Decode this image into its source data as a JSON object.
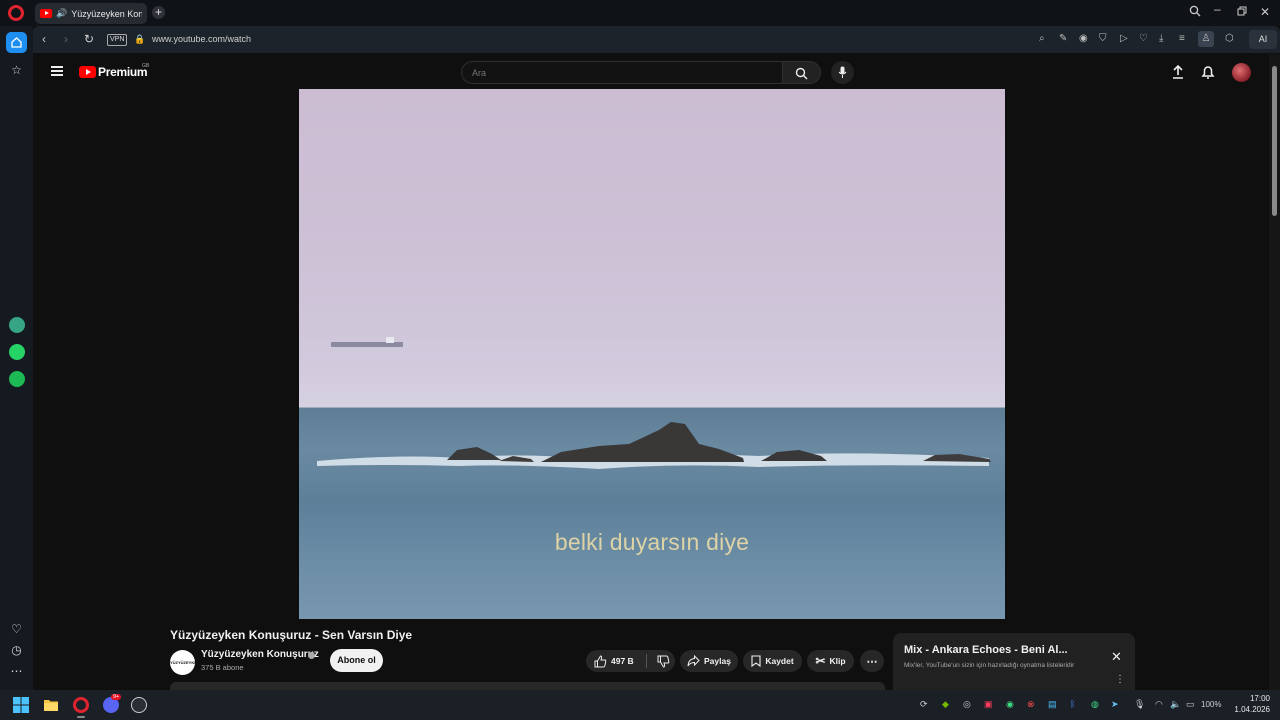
{
  "browser": {
    "tab_title": "Yüzyüzeyken Konuşuruz",
    "new_tab_symbol": "+",
    "vpn_label": "VPN",
    "url": "www.youtube.com/watch",
    "ai_label": "AI"
  },
  "youtube": {
    "brand": "Premium",
    "brand_region": "GB",
    "search_placeholder": "Ara"
  },
  "video": {
    "caption": "belki duyarsın diye",
    "title": "Yüzyüzeyken Konuşuruz - Sen Varsın Diye"
  },
  "channel": {
    "avatar_text": "YÜZYÜZEYKEN KONUŞURUZ",
    "name": "Yüzyüzeyken Konuşuruz",
    "subscribers": "375 B abone",
    "subscribe_label": "Abone ol"
  },
  "actions": {
    "likes": "497 B",
    "share": "Paylaş",
    "save": "Kaydet",
    "clip": "Klip"
  },
  "mix": {
    "title": "Mix - Ankara Echoes - Beni Al...",
    "subtitle": "Mix'ler, YouTube'un sizin için hazırladığı oynatma listeleridir"
  },
  "taskbar": {
    "discord_badge": "9+",
    "battery": "100%",
    "time": "17:00",
    "date": "1.04.2026"
  },
  "colors": {
    "accent": "#1f8ef1",
    "youtube_red": "#ff0000",
    "caption": "#ddd3a6"
  }
}
